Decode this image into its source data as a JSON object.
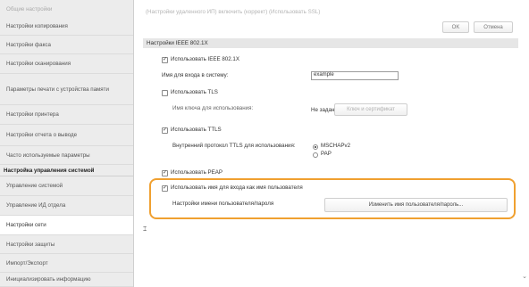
{
  "sidebar": {
    "items": [
      {
        "label": "Общие настройки"
      },
      {
        "label": "Настройки копирования"
      },
      {
        "label": "Настройки факса"
      },
      {
        "label": "Настройки сканирования"
      },
      {
        "label": "Параметры печати с устройства памяти"
      },
      {
        "label": "Настройки принтера"
      },
      {
        "label": "Настройки отчета о выводе"
      },
      {
        "label": "Часто используемые параметры"
      },
      {
        "label": "Настройка управления системой"
      },
      {
        "label": "Управление системой"
      },
      {
        "label": "Управление ИД отдела"
      },
      {
        "label": "Настройки сети"
      },
      {
        "label": "Настройки защиты"
      },
      {
        "label": "Импорт/Экспорт"
      },
      {
        "label": "Инициализировать информацию"
      }
    ]
  },
  "header": {
    "top_text": "(Настройки удаленного ИП) включить (коррект) (Использовать SSL)",
    "ok_label": "OK",
    "cancel_label": "Отмена"
  },
  "section": {
    "title": "Настройки IEEE 802.1X"
  },
  "form": {
    "use_ieee_label": "Использовать IEEE 802.1X",
    "login_name_label": "Имя для входа в систему:",
    "login_name_value": "example",
    "use_tls_label": "Использовать TLS",
    "key_name_label": "Имя ключа для использования:",
    "key_name_value": "Не задано",
    "key_cert_button": "Ключ и сертификат",
    "use_ttls_label": "Использовать TTLS",
    "ttls_protocol_label": "Внутренний протокол TTLS для использования:",
    "mschap_label": "MSCHAPv2",
    "pap_label": "PAP",
    "use_peap_label": "Использовать PEAP",
    "use_login_as_user_label": "Использовать имя для входа как имя пользователя",
    "user_password_label": "Настройки имени пользователя/пароля",
    "change_user_password_button": "Изменить имя пользователя/пароль..."
  },
  "colors": {
    "highlight": "#f0a030",
    "sidebar_bg": "#ececec",
    "section_bar": "#e6e6e6"
  }
}
